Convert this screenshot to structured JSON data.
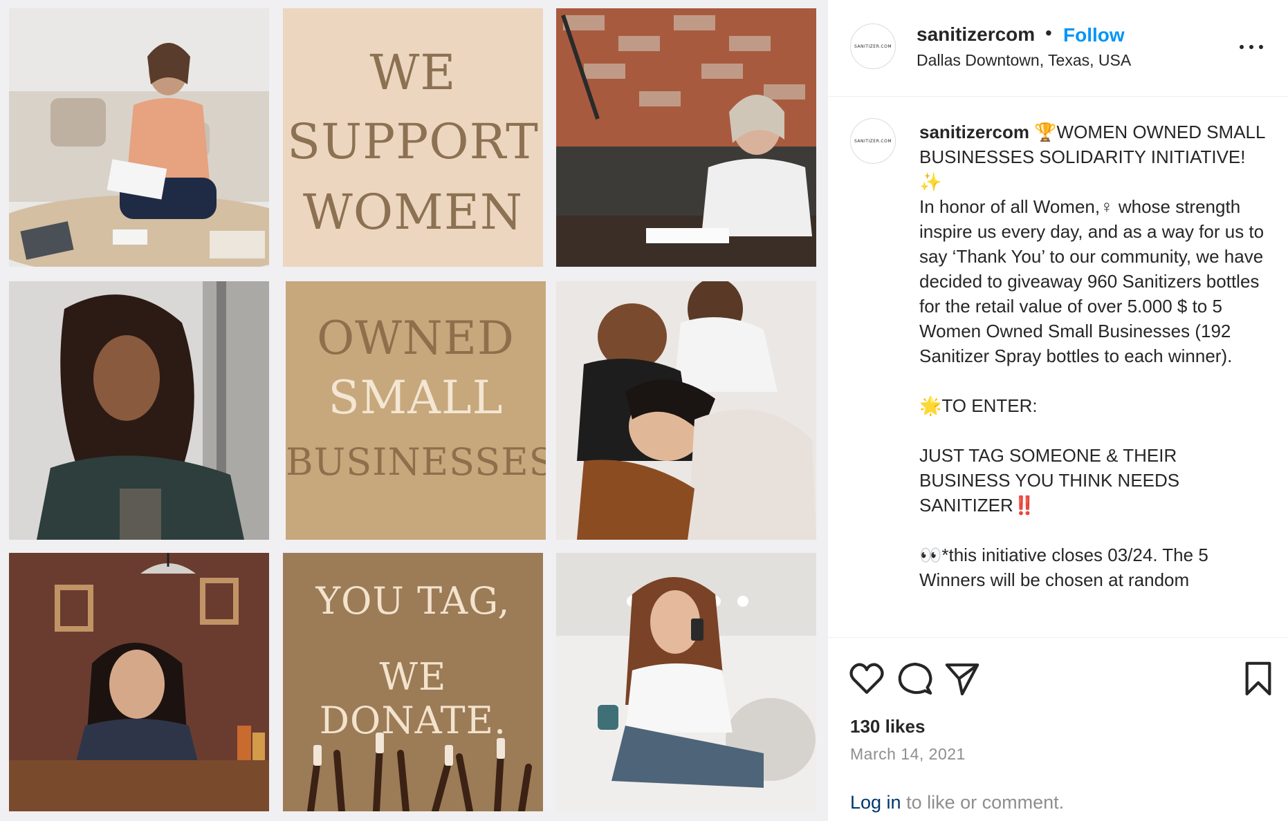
{
  "colors": {
    "follow_blue": "#0095f6",
    "link_dark_blue": "#00376b",
    "muted_gray": "#8e8e8e",
    "text_dark": "#262626",
    "tile_cream": "#ecd6bf",
    "tile_tan": "#c7a77c",
    "tile_brown": "#9c7b57"
  },
  "media": {
    "tile_we_support_women": [
      "WE",
      "SUPPORT",
      "WOMEN"
    ],
    "tile_owned_small_businesses": [
      "OWNED",
      "SMALL",
      "BUSINESSES"
    ],
    "tile_you_tag_we_donate": [
      "YOU TAG,",
      "WE DONATE."
    ]
  },
  "header": {
    "avatar_text": "SANITIZER.COM",
    "username": "sanitizercom",
    "separator": "•",
    "follow_label": "Follow",
    "location": "Dallas Downtown, Texas, USA",
    "more_icon": "more-horizontal-icon"
  },
  "caption": {
    "avatar_text": "SANITIZER.COM",
    "username": "sanitizercom",
    "text": " 🏆WOMEN OWNED SMALL BUSINESSES SOLIDARITY INITIATIVE! ✨\nIn honor of all Women,♀ whose strength inspire us every day, and as a way for us to say ‘Thank You’ to our community, we have decided to giveaway 960 Sanitizers bottles for the retail value of over 5.000 $ to 5 Women Owned Small Businesses (192 Sanitizer Spray bottles to each winner).\n\n🌟TO ENTER:\n\nJUST TAG SOMEONE & THEIR BUSINESS YOU THINK NEEDS SANITIZER‼️\n\n👀*this initiative closes 03/24. The 5 Winners will be chosen at random"
  },
  "actions": {
    "like_icon": "heart-icon",
    "comment_icon": "comment-icon",
    "share_icon": "paper-plane-icon",
    "save_icon": "bookmark-icon"
  },
  "stats": {
    "likes": "130 likes",
    "date": "March 14, 2021"
  },
  "footer": {
    "login_link": "Log in",
    "login_suffix": " to like or comment."
  }
}
